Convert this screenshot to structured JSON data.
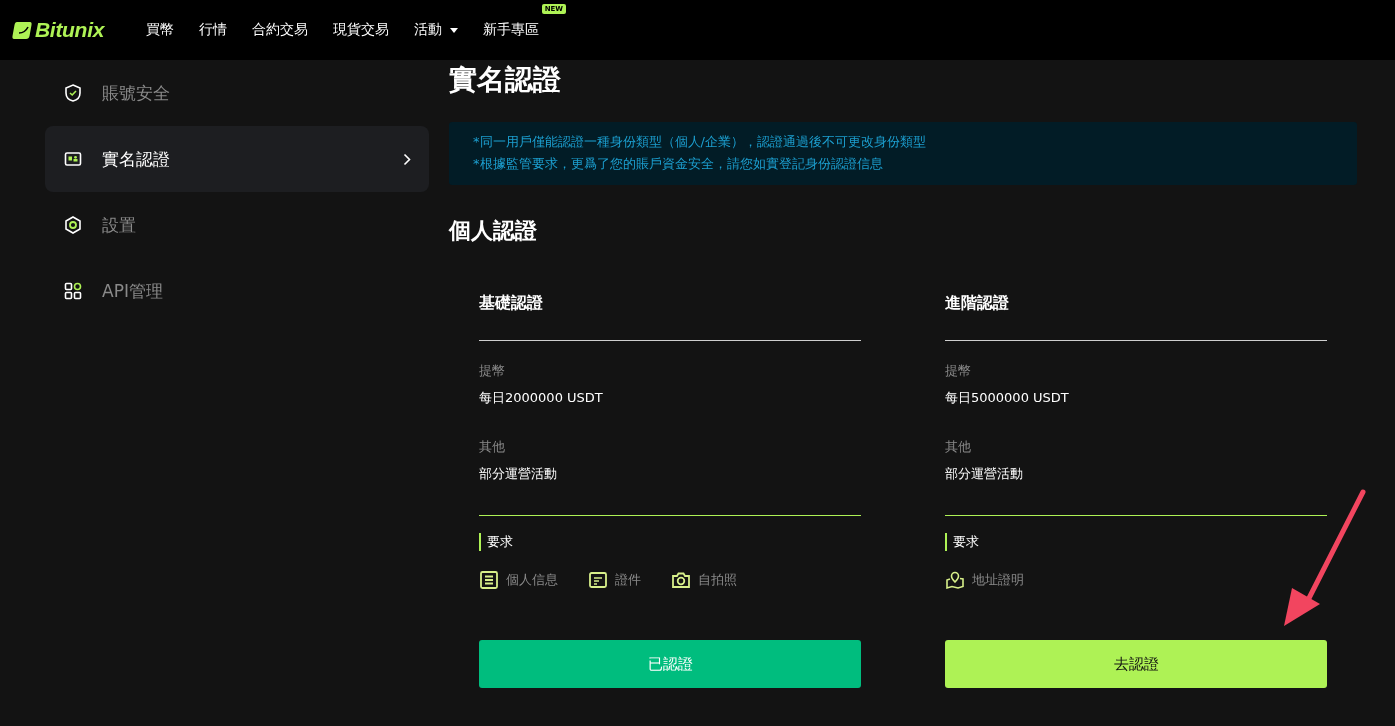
{
  "nav": {
    "logo": "Bitunix",
    "items": [
      {
        "label": "買幣",
        "dropdown": false
      },
      {
        "label": "行情",
        "dropdown": false
      },
      {
        "label": "合約交易",
        "dropdown": false
      },
      {
        "label": "現貨交易",
        "dropdown": false
      },
      {
        "label": "活動",
        "dropdown": true
      },
      {
        "label": "新手專區",
        "dropdown": false,
        "badge": "NEW"
      }
    ]
  },
  "sidebar": {
    "items": [
      {
        "kind": "shield",
        "label": "賬號安全",
        "selected": false
      },
      {
        "kind": "idcard",
        "label": "實名認證",
        "selected": true
      },
      {
        "kind": "hexagon",
        "label": "設置",
        "selected": false
      },
      {
        "kind": "grid",
        "label": "API管理",
        "selected": false
      }
    ]
  },
  "page_title": "實名認證",
  "notice": [
    "*同一用戶僅能認證一種身份類型（個人/企業），認證通過後不可更改身份類型",
    "*根據監管要求，更爲了您的賬戶資金安全，請您如實登記身份認證信息"
  ],
  "section_title": "個人認證",
  "levels": [
    {
      "title": "基礎認證",
      "limits": [
        {
          "label": "提幣",
          "value": "每日2000000 USDT"
        },
        {
          "label": "其他",
          "value": "部分運營活動"
        }
      ],
      "requirements_label": "要求",
      "requirements": [
        {
          "kind": "info",
          "label": "個人信息"
        },
        {
          "kind": "document",
          "label": "證件"
        },
        {
          "kind": "camera",
          "label": "自拍照"
        }
      ],
      "button": {
        "label": "已認證",
        "verified": true
      }
    },
    {
      "title": "進階認證",
      "limits": [
        {
          "label": "提幣",
          "value": "每日5000000 USDT"
        },
        {
          "label": "其他",
          "value": "部分運營活動"
        }
      ],
      "requirements_label": "要求",
      "requirements": [
        {
          "kind": "address",
          "label": "地址證明"
        }
      ],
      "button": {
        "label": "去認證",
        "verified": false
      }
    }
  ]
}
